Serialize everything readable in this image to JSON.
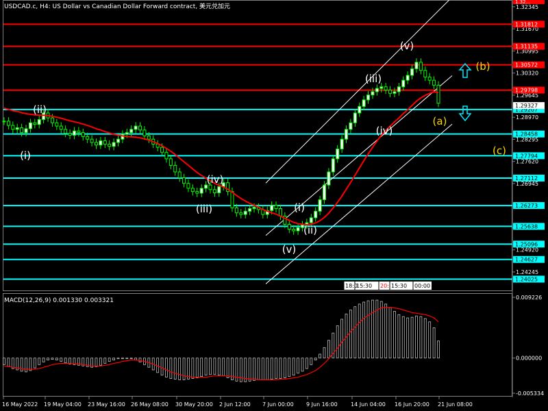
{
  "window": {
    "title": "USDCAD.c, H4:  US Dollar vs Canadian Dollar Forward contract, 美元兑加元"
  },
  "chart_data": [
    {
      "type": "candlestick",
      "symbol": "USDCAD.c",
      "timeframe": "H4",
      "title": "USDCAD.c, H4:  US Dollar vs Canadian Dollar Forward contract, 美元兑加元",
      "ylim": [
        1.2368,
        1.3253
      ],
      "axis_ticks": [
        "1.32345",
        "1.31670",
        "1.30995",
        "1.30320",
        "1.29645",
        "1.28970",
        "1.28295",
        "1.27620",
        "1.26945",
        "1.26270",
        "1.25595",
        "1.24920",
        "1.24245"
      ],
      "x_labels": [
        "16 May 2022",
        "19 May 04:00",
        "23 May 16:00",
        "26 May 08:00",
        "30 May 20:00",
        "2 Jun 12:00",
        "7 Jun 00:00",
        "9 Jun 16:00",
        "14 Jun 04:00",
        "16 Jun 20:00",
        "21 Jun 08:00"
      ],
      "levels_red": [
        {
          "value": 1.31812,
          "label": "1.31812"
        },
        {
          "value": 1.31135,
          "label": "1.31135"
        },
        {
          "value": 1.30572,
          "label": "1.30572"
        },
        {
          "value": 1.29798,
          "label": "1.29798"
        }
      ],
      "levels_cyan": [
        {
          "value": 1.29207,
          "label": "1.29207"
        },
        {
          "value": 1.28458,
          "label": "1.28458"
        },
        {
          "value": 1.27794,
          "label": "1.27794"
        },
        {
          "value": 1.27112,
          "label": "1.27112"
        },
        {
          "value": 1.26273,
          "label": "1.26273"
        },
        {
          "value": 1.25638,
          "label": "1.25638"
        },
        {
          "value": 1.25096,
          "label": "1.25096"
        },
        {
          "value": 1.24627,
          "label": "1.24627"
        },
        {
          "value": 1.24025,
          "label": "1.24025"
        }
      ],
      "top_clipped_label": "1.32...",
      "bid_price": {
        "value": 1.29327,
        "label": "1.29327"
      },
      "close_series": [
        1.2885,
        1.2872,
        1.286,
        1.2865,
        1.285,
        1.2862,
        1.288,
        1.2875,
        1.289,
        1.291,
        1.2895,
        1.288,
        1.287,
        1.286,
        1.2848,
        1.2842,
        1.2855,
        1.285,
        1.2838,
        1.283,
        1.282,
        1.2812,
        1.2825,
        1.2815,
        1.2808,
        1.282,
        1.283,
        1.2845,
        1.285,
        1.286,
        1.287,
        1.2858,
        1.284,
        1.283,
        1.2815,
        1.2805,
        1.279,
        1.277,
        1.275,
        1.273,
        1.2712,
        1.2695,
        1.268,
        1.267,
        1.2665,
        1.268,
        1.269,
        1.2676,
        1.2666,
        1.2685,
        1.2697,
        1.267,
        1.262,
        1.2605,
        1.26,
        1.261,
        1.2618,
        1.2622,
        1.2615,
        1.26,
        1.2612,
        1.2628,
        1.2618,
        1.2595,
        1.257,
        1.2555,
        1.255,
        1.256,
        1.2568,
        1.2575,
        1.259,
        1.261,
        1.2645,
        1.269,
        1.273,
        1.277,
        1.28,
        1.283,
        1.286,
        1.288,
        1.291,
        1.293,
        1.295,
        1.2965,
        1.2975,
        1.2985,
        1.299,
        1.298,
        1.297,
        1.2975,
        1.299,
        1.301,
        1.3025,
        1.3045,
        1.3065,
        1.304,
        1.302,
        1.301,
        1.2995,
        1.294
      ],
      "ma_series": [
        1.2925,
        1.2921,
        1.2917,
        1.2915,
        1.2911,
        1.2908,
        1.2906,
        1.2904,
        1.2903,
        1.2903,
        1.2902,
        1.29,
        1.2897,
        1.2894,
        1.289,
        1.2886,
        1.2883,
        1.288,
        1.2876,
        1.2872,
        1.2867,
        1.2862,
        1.2858,
        1.2853,
        1.2849,
        1.2845,
        1.2842,
        1.284,
        1.2838,
        1.2837,
        1.2836,
        1.2834,
        1.2831,
        1.2827,
        1.2822,
        1.2817,
        1.281,
        1.2802,
        1.2793,
        1.2783,
        1.2772,
        1.2761,
        1.275,
        1.2739,
        1.2728,
        1.2719,
        1.2711,
        1.2703,
        1.2695,
        1.2689,
        1.2684,
        1.2677,
        1.2668,
        1.2658,
        1.2649,
        1.2641,
        1.2634,
        1.2628,
        1.2622,
        1.2615,
        1.261,
        1.2605,
        1.2601,
        1.2595,
        1.2588,
        1.2582,
        1.2576,
        1.2572,
        1.257,
        1.2569,
        1.257,
        1.2574,
        1.2581,
        1.2591,
        1.2604,
        1.262,
        1.2637,
        1.2656,
        1.2677,
        1.2698,
        1.272,
        1.2742,
        1.2764,
        1.2785,
        1.2805,
        1.2824,
        1.2842,
        1.2857,
        1.287,
        1.2883,
        1.2895,
        1.2908,
        1.292,
        1.2933,
        1.2946,
        1.2956,
        1.2964,
        1.297,
        1.2975,
        1.2972
      ],
      "channel": {
        "lower": [
          [
            1.2388,
            1.2876
          ]
        ],
        "middle": [
          [
            1.2536,
            1.3024
          ]
        ],
        "upper": [
          [
            1.2696,
            1.3264
          ]
        ]
      },
      "wave_labels": [
        {
          "text": "(ii)",
          "color": "#ffffff"
        },
        {
          "text": "(i)",
          "color": "#ffffff"
        },
        {
          "text": "(iv)",
          "color": "#ffffff"
        },
        {
          "text": "(iii)",
          "color": "#ffffff"
        },
        {
          "text": "(i)",
          "color": "#ffffff"
        },
        {
          "text": "(ii)",
          "color": "#ffffff"
        },
        {
          "text": "(v)",
          "color": "#ffffff"
        },
        {
          "text": "(iii)",
          "color": "#ffffff"
        },
        {
          "text": "(iv)",
          "color": "#ffffff"
        },
        {
          "text": "(v)",
          "color": "#ffffff"
        },
        {
          "text": "(a)",
          "color": "#ffd700"
        },
        {
          "text": "(b)",
          "color": "#ffd700"
        },
        {
          "text": "(c)",
          "color": "#ffd700"
        }
      ],
      "arrows": [
        {
          "direction": "up",
          "color": "#00e5ff"
        },
        {
          "direction": "down",
          "color": "#00e5ff"
        }
      ],
      "session_marks": [
        "18:0",
        "15:30",
        "20:",
        "15:30",
        "00:00"
      ],
      "colors": {
        "candles": "#00ff00",
        "ma": "#ff0000",
        "red_level": "#ff0000",
        "cyan_level": "#00ffff",
        "channel": "#ffffff"
      }
    },
    {
      "type": "histogram",
      "title": "MACD(12,26,9) 0.001330 0.003321",
      "axis_ticks": [
        "0.009226",
        "0.000000",
        "-0.005334"
      ],
      "ylim": [
        -0.005334,
        0.009226
      ],
      "values": [
        -0.001,
        -0.0013,
        -0.0016,
        -0.0018,
        -0.002,
        -0.0021,
        -0.0019,
        -0.0015,
        -0.001,
        -0.0006,
        -0.0003,
        -0.0002,
        -0.0003,
        -0.0005,
        -0.0007,
        -0.0009,
        -0.001,
        -0.0011,
        -0.0012,
        -0.0013,
        -0.0014,
        -0.0013,
        -0.0011,
        -0.0008,
        -0.0005,
        -0.0003,
        -0.0001,
        0.0,
        0.0,
        -0.0001,
        -0.0003,
        -0.0006,
        -0.001,
        -0.0014,
        -0.0018,
        -0.0022,
        -0.0026,
        -0.0029,
        -0.0031,
        -0.0032,
        -0.0033,
        -0.0033,
        -0.0032,
        -0.0031,
        -0.003,
        -0.0028,
        -0.0026,
        -0.0025,
        -0.0025,
        -0.0026,
        -0.0027,
        -0.003,
        -0.0033,
        -0.0035,
        -0.0036,
        -0.0036,
        -0.0035,
        -0.0034,
        -0.0033,
        -0.0033,
        -0.0033,
        -0.0032,
        -0.0031,
        -0.0031,
        -0.003,
        -0.0028,
        -0.0026,
        -0.0023,
        -0.002,
        -0.0016,
        -0.001,
        -0.0003,
        0.0006,
        0.0016,
        0.0027,
        0.0038,
        0.0049,
        0.0059,
        0.0067,
        0.0073,
        0.0078,
        0.0082,
        0.0085,
        0.0087,
        0.0088,
        0.0088,
        0.0086,
        0.0082,
        0.0077,
        0.0071,
        0.0066,
        0.0063,
        0.0061,
        0.0062,
        0.0064,
        0.0063,
        0.006,
        0.0055,
        0.0046,
        0.0026
      ],
      "signal": [
        -0.0012,
        -0.0013,
        -0.0014,
        -0.0015,
        -0.0016,
        -0.0017,
        -0.0017,
        -0.0017,
        -0.0016,
        -0.0014,
        -0.0012,
        -0.001,
        -0.0009,
        -0.0008,
        -0.0008,
        -0.0008,
        -0.0009,
        -0.0009,
        -0.001,
        -0.0011,
        -0.0012,
        -0.0012,
        -0.0012,
        -0.0011,
        -0.001,
        -0.0008,
        -0.0007,
        -0.0005,
        -0.0004,
        -0.0003,
        -0.0003,
        -0.0004,
        -0.0005,
        -0.0007,
        -0.0009,
        -0.0012,
        -0.0015,
        -0.0018,
        -0.0021,
        -0.0023,
        -0.0025,
        -0.0027,
        -0.0028,
        -0.0029,
        -0.0029,
        -0.0029,
        -0.0029,
        -0.0028,
        -0.0027,
        -0.0027,
        -0.0027,
        -0.0027,
        -0.0028,
        -0.0029,
        -0.003,
        -0.0031,
        -0.0032,
        -0.0032,
        -0.0033,
        -0.0033,
        -0.0033,
        -0.0033,
        -0.0033,
        -0.0032,
        -0.0032,
        -0.0031,
        -0.003,
        -0.0029,
        -0.0027,
        -0.0025,
        -0.0022,
        -0.0019,
        -0.0014,
        -0.0008,
        -0.0001,
        0.0007,
        0.0015,
        0.0024,
        0.0032,
        0.004,
        0.0047,
        0.0054,
        0.006,
        0.0065,
        0.0069,
        0.0073,
        0.0076,
        0.0077,
        0.0077,
        0.0076,
        0.0075,
        0.0073,
        0.0071,
        0.0069,
        0.0068,
        0.0067,
        0.0066,
        0.0064,
        0.0061,
        0.0055
      ],
      "colors": {
        "histogram": "#c0c0c0",
        "signal": "#ff0000"
      }
    }
  ]
}
